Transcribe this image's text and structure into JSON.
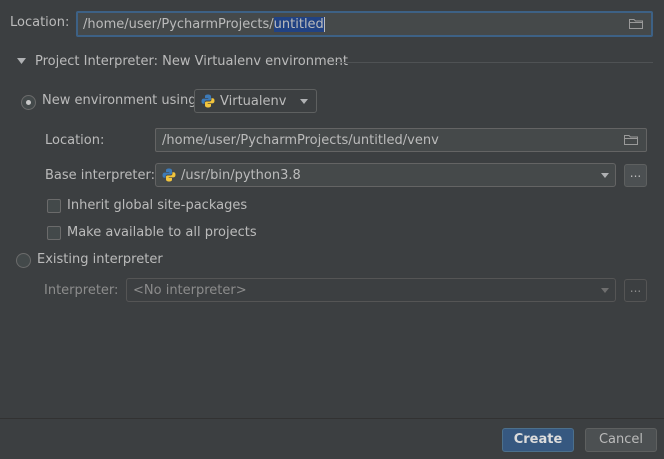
{
  "top_location": {
    "label": "Location:",
    "value_prefix": "/home/user/PycharmProjects/",
    "value_selected": "untitled",
    "browse_icon": "folder-icon"
  },
  "section": {
    "title": "Project Interpreter: New Virtualenv environment",
    "toggle_icon": "triangle-down-icon"
  },
  "new_env": {
    "radio_label": "New environment using",
    "selected": true,
    "tool_value": "Virtualenv",
    "tool_icon": "python-icon",
    "location_label": "Location:",
    "location_value": "/home/user/PycharmProjects/untitled/venv",
    "base_label": "Base interpreter:",
    "base_value": "/usr/bin/python3.8",
    "browse_label": "...",
    "inherit_label": "Inherit global site-packages",
    "inherit_checked": false,
    "make_available_label": "Make available to all projects",
    "make_available_checked": false
  },
  "existing": {
    "radio_label": "Existing interpreter",
    "selected": false,
    "interpreter_label": "Interpreter:",
    "interpreter_value": "<No interpreter>",
    "browse_label": "..."
  },
  "footer": {
    "create_label": "Create",
    "cancel_label": "Cancel"
  },
  "colors": {
    "background": "#3c3f41",
    "primary_button": "#365880",
    "selection": "#214283",
    "focus_border": "#3d6185"
  }
}
